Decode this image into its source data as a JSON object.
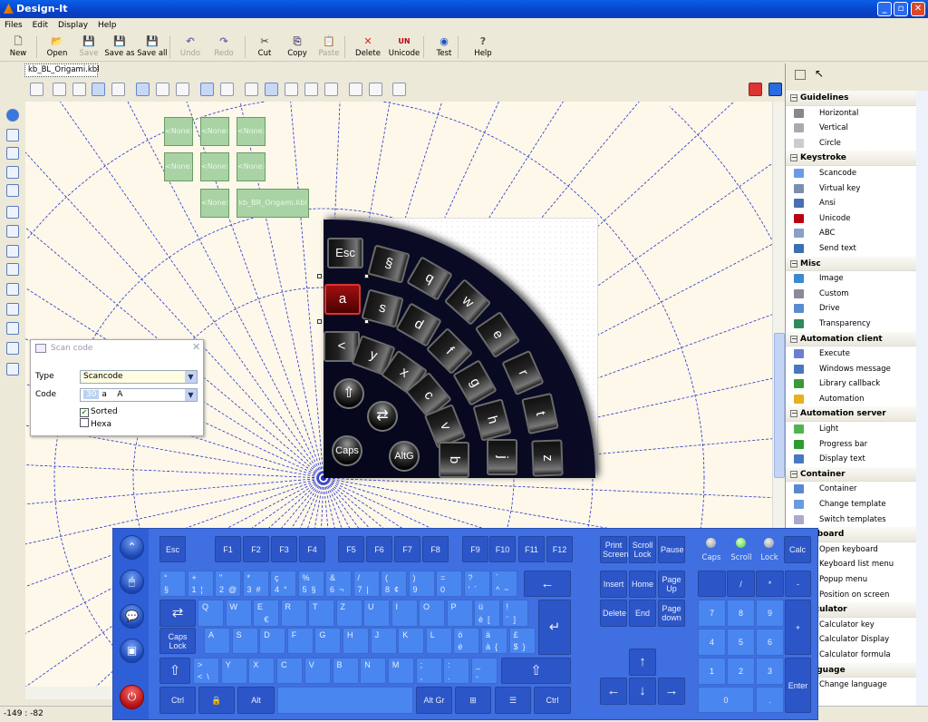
{
  "window": {
    "title": "Design-It"
  },
  "menu": [
    "Files",
    "Edit",
    "Display",
    "Help"
  ],
  "toolbar": [
    {
      "label": "New",
      "icon": "new-file-icon",
      "enabled": true
    },
    {
      "label": "Open",
      "icon": "open-folder-icon",
      "enabled": true
    },
    {
      "label": "Save",
      "icon": "save-icon",
      "enabled": false
    },
    {
      "label": "Save as",
      "icon": "save-as-icon",
      "enabled": true
    },
    {
      "label": "Save all",
      "icon": "save-all-icon",
      "enabled": true
    },
    {
      "label": "Undo",
      "icon": "undo-icon",
      "enabled": false
    },
    {
      "label": "Redo",
      "icon": "redo-icon",
      "enabled": false
    },
    {
      "label": "Cut",
      "icon": "scissors-icon",
      "enabled": true
    },
    {
      "label": "Copy",
      "icon": "copy-icon",
      "enabled": true
    },
    {
      "label": "Paste",
      "icon": "paste-icon",
      "enabled": false
    },
    {
      "label": "Delete",
      "icon": "delete-x-icon",
      "enabled": true
    },
    {
      "label": "Unicode",
      "icon": "unicode-icon",
      "enabled": true
    },
    {
      "label": "Test",
      "icon": "play-circle-icon",
      "enabled": true
    },
    {
      "label": "Help",
      "icon": "help-icon",
      "enabled": true
    }
  ],
  "document_tab": "kb_BL_Origami.kbl",
  "canvas": {
    "placeholders": [
      "<None>",
      "<None>",
      "<None>",
      "<None>",
      "<None>",
      "<None>",
      "<None>"
    ],
    "linked_layout": "kb_BR_Origami.kbl"
  },
  "origami": {
    "keys": [
      "Esc",
      "§",
      "q",
      "w",
      "e",
      "r",
      "t",
      "z",
      "a",
      "s",
      "d",
      "f",
      "g",
      "h",
      "j",
      "<",
      "y",
      "x",
      "c",
      "v",
      "b"
    ],
    "round_keys": [
      "⇧",
      "⇄",
      "Caps",
      "AltG"
    ],
    "selected": "a"
  },
  "scan_dialog": {
    "title": "Scan code",
    "type_label": "Type",
    "type_value": "Scancode",
    "code_label": "Code",
    "code_number": "30",
    "code_chars": "a    A",
    "sorted_label": "Sorted",
    "sorted": true,
    "hexa_label": "Hexa",
    "hexa": false
  },
  "panel": {
    "sections": [
      {
        "title": "Guidelines",
        "items": [
          "Horizontal",
          "Vertical",
          "Circle"
        ]
      },
      {
        "title": "Keystroke",
        "items": [
          "Scancode",
          "Virtual key",
          "Ansi",
          "Unicode",
          "ABC",
          "Send text"
        ]
      },
      {
        "title": "Misc",
        "items": [
          "Image",
          "Custom",
          "Drive",
          "Transparency"
        ]
      },
      {
        "title": "Automation client",
        "items": [
          "Execute",
          "Windows message",
          "Library callback",
          "Automation"
        ]
      },
      {
        "title": "Automation server",
        "items": [
          "Light",
          "Progress bar",
          "Display text"
        ]
      },
      {
        "title": "Container",
        "items": [
          "Container",
          "Change template",
          "Switch templates"
        ]
      },
      {
        "title": "Keyboard",
        "items": [
          "Open keyboard",
          "Keyboard list menu",
          "Popup menu",
          "Position on screen"
        ]
      },
      {
        "title": "Calculator",
        "items": [
          "Calculator key",
          "Calculator Display",
          "Calculator formula"
        ]
      },
      {
        "title": "Language",
        "items": [
          "Change language"
        ]
      }
    ]
  },
  "status": "-149 : -82",
  "osk": {
    "frow": [
      "Esc",
      "F1",
      "F2",
      "F3",
      "F4",
      "F5",
      "F6",
      "F7",
      "F8",
      "F9",
      "F10",
      "F11",
      "F12"
    ],
    "numrow": [
      {
        "top": "°",
        "bottom": "§"
      },
      {
        "top": "+",
        "bottom": "1  ¦"
      },
      {
        "top": "\"",
        "bottom": "2  @"
      },
      {
        "top": "*",
        "bottom": "3  #"
      },
      {
        "top": "ç",
        "bottom": "4  °"
      },
      {
        "top": "%",
        "bottom": "5  §"
      },
      {
        "top": "&",
        "bottom": "6  ¬"
      },
      {
        "top": "/",
        "bottom": "7  |"
      },
      {
        "top": "(",
        "bottom": "8  ¢"
      },
      {
        "top": ")",
        "bottom": "9"
      },
      {
        "top": "=",
        "bottom": "0"
      },
      {
        "top": "?",
        "bottom": "'  ´"
      },
      {
        "top": "`",
        "bottom": "^  ~"
      }
    ],
    "backspace": "←",
    "tab": "⇄",
    "qrow": [
      {
        "top": "Q",
        "bottom": ""
      },
      {
        "top": "W",
        "bottom": ""
      },
      {
        "top": "E",
        "bottom": "   €"
      },
      {
        "top": "R",
        "bottom": ""
      },
      {
        "top": "T",
        "bottom": ""
      },
      {
        "top": "Z",
        "bottom": ""
      },
      {
        "top": "U",
        "bottom": ""
      },
      {
        "top": "I",
        "bottom": ""
      },
      {
        "top": "O",
        "bottom": ""
      },
      {
        "top": "P",
        "bottom": ""
      },
      {
        "top": "ü",
        "bottom": "è  ["
      },
      {
        "top": "!",
        "bottom": "¨  ]"
      }
    ],
    "enter": "↵",
    "caps": "Caps Lock",
    "arow": [
      {
        "top": "A",
        "bottom": ""
      },
      {
        "top": "S",
        "bottom": ""
      },
      {
        "top": "D",
        "bottom": ""
      },
      {
        "top": "F",
        "bottom": ""
      },
      {
        "top": "G",
        "bottom": ""
      },
      {
        "top": "H",
        "bottom": ""
      },
      {
        "top": "J",
        "bottom": ""
      },
      {
        "top": "K",
        "bottom": ""
      },
      {
        "top": "L",
        "bottom": ""
      },
      {
        "top": "ö",
        "bottom": "é"
      },
      {
        "top": "ä",
        "bottom": "à  {"
      },
      {
        "top": "£",
        "bottom": "$  }"
      }
    ],
    "shift": "⇧",
    "srow": [
      {
        "top": ">",
        "bottom": "<  \\"
      },
      {
        "top": "Y",
        "bottom": ""
      },
      {
        "top": "X",
        "bottom": ""
      },
      {
        "top": "C",
        "bottom": ""
      },
      {
        "top": "V",
        "bottom": ""
      },
      {
        "top": "B",
        "bottom": ""
      },
      {
        "top": "N",
        "bottom": ""
      },
      {
        "top": "M",
        "bottom": ""
      },
      {
        "top": ";",
        "bottom": ","
      },
      {
        "top": ":",
        "bottom": "."
      },
      {
        "top": "_",
        "bottom": "-"
      }
    ],
    "bottom": [
      "Ctrl",
      "🔒",
      "Alt",
      "",
      "Alt Gr",
      "⊞",
      "☰",
      "Ctrl"
    ],
    "nav": [
      "Print Screen",
      "Scroll Lock",
      "Pause",
      "Insert",
      "Home",
      "Page Up",
      "Delete",
      "End",
      "Page down"
    ],
    "arrows": [
      "↑",
      "←",
      "↓",
      "→"
    ],
    "lights": [
      {
        "label": "Caps",
        "on": false
      },
      {
        "label": "Scroll",
        "on": true
      },
      {
        "label": "Lock",
        "on": false
      }
    ],
    "numpad": [
      "Calc",
      "",
      "/",
      "*",
      "-",
      "7",
      "8",
      "9",
      "+",
      "4",
      "5",
      "6",
      "1",
      "2",
      "3",
      "Enter",
      "0",
      "."
    ],
    "side": [
      "⌃",
      "🖱",
      "💬",
      "▣",
      "⏻"
    ]
  }
}
